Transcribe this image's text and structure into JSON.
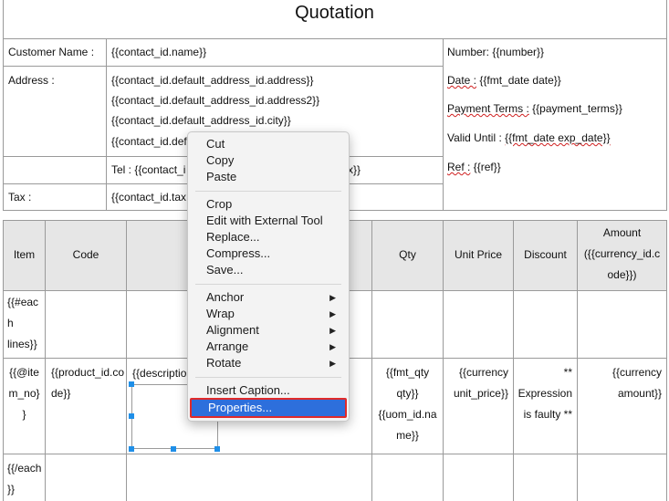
{
  "document": {
    "title": "Quotation",
    "customer": {
      "name_label": "Customer Name :",
      "name_value": "{{contact_id.name}}",
      "address_label": "Address :",
      "address_lines": [
        "{{contact_id.default_address_id.address}}",
        "{{contact_id.default_address_id.address2}}",
        "{{contact_id.default_address_id.city}}",
        "{{contact_id.defa"
      ],
      "tel": "Tel : {{contact_i",
      "tel_tail": "x}}",
      "tax_label": "Tax :",
      "tax_value": "{{contact_id.tax"
    },
    "info": {
      "number": "Number: {{number}}",
      "date_label": "Date :",
      "date_value": "{{fmt_date date}}",
      "payment_terms_label": "Payment Terms :",
      "payment_terms_value": "{{payment_terms}}",
      "valid_until_label": "Valid Until :",
      "valid_until_value": "{{fmt_date exp_date}}",
      "ref_label": "Ref :",
      "ref_value": "{{ref}}"
    },
    "table": {
      "headers": {
        "item": "Item",
        "code": "Code",
        "qty": "Qty",
        "unit_price": "Unit Price",
        "discount": "Discount",
        "amount": [
          "Amount",
          "({{currency_id.c",
          "ode}})"
        ]
      },
      "row1": {
        "item": [
          "{{#eac",
          "h",
          "lines}}"
        ]
      },
      "row2": {
        "item": [
          "{{@ite",
          "m_no}",
          "}"
        ],
        "code": [
          "{{product_id.co",
          "de}}"
        ],
        "description": "{{description",
        "qty": [
          "{{fmt_qty",
          "qty}}",
          "{{uom_id.na",
          "me}}"
        ],
        "unit_price": [
          "{{currency",
          "unit_price}}"
        ],
        "discount": [
          "**",
          "Expression",
          "is faulty **"
        ],
        "amount": [
          "{{currency",
          "amount}}"
        ]
      },
      "row3": {
        "item": [
          "{{/each",
          "}}"
        ]
      }
    }
  },
  "context_menu": {
    "items": [
      {
        "label": "Cut"
      },
      {
        "label": "Copy"
      },
      {
        "label": "Paste"
      },
      {
        "label": "Crop"
      },
      {
        "label": "Edit with External Tool"
      },
      {
        "label": "Replace..."
      },
      {
        "label": "Compress..."
      },
      {
        "label": "Save..."
      },
      {
        "label": "Anchor",
        "submenu": true
      },
      {
        "label": "Wrap",
        "submenu": true
      },
      {
        "label": "Alignment",
        "submenu": true
      },
      {
        "label": "Arrange",
        "submenu": true
      },
      {
        "label": "Rotate",
        "submenu": true
      },
      {
        "label": "Insert Caption..."
      },
      {
        "label": "Properties...",
        "highlighted": true
      }
    ],
    "submenu_glyph": "▶",
    "highlight_color": "#2d6fdc",
    "annotation_color": "#e02a2a"
  }
}
